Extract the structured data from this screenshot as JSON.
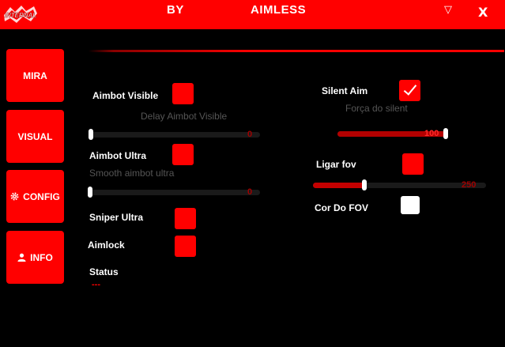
{
  "window": {
    "title_by": "BY",
    "title_name": "AIMLESS",
    "logo_text": "INTERNAL",
    "minimize_glyph": "▽",
    "close_glyph": "X",
    "accent_color": "#ff0000"
  },
  "nav": {
    "mira": "MIRA",
    "visual": "VISUAL",
    "config": "CONFIG",
    "info": "INFO"
  },
  "options": {
    "aimbot_visible": {
      "label": "Aimbot Visible",
      "checked": false
    },
    "delay_aimbot_visible": {
      "label": "Delay Aimbot Visible",
      "value": "0",
      "fraction": 0
    },
    "aimbot_ultra": {
      "label": "Aimbot Ultra",
      "checked": false
    },
    "smooth_aimbot_ultra": {
      "label": "Smooth aimbot ultra",
      "value": "0",
      "fraction": 0
    },
    "sniper_ultra": {
      "label": "Sniper Ultra",
      "checked": false
    },
    "aimlock": {
      "label": "Aimlock",
      "checked": false
    },
    "status": {
      "label": "Status",
      "value": "---"
    },
    "silent_aim": {
      "label": "Silent Aim",
      "checked": true
    },
    "forca_silent": {
      "label": "Força do silent",
      "value": "100",
      "fraction": 1.0
    },
    "ligar_fov": {
      "label": "Ligar fov",
      "checked": false
    },
    "fov_slider": {
      "value": "250",
      "fraction": 0.29
    },
    "cor_do_fov": {
      "label": "Cor Do FOV",
      "color": "#ffffff"
    }
  }
}
